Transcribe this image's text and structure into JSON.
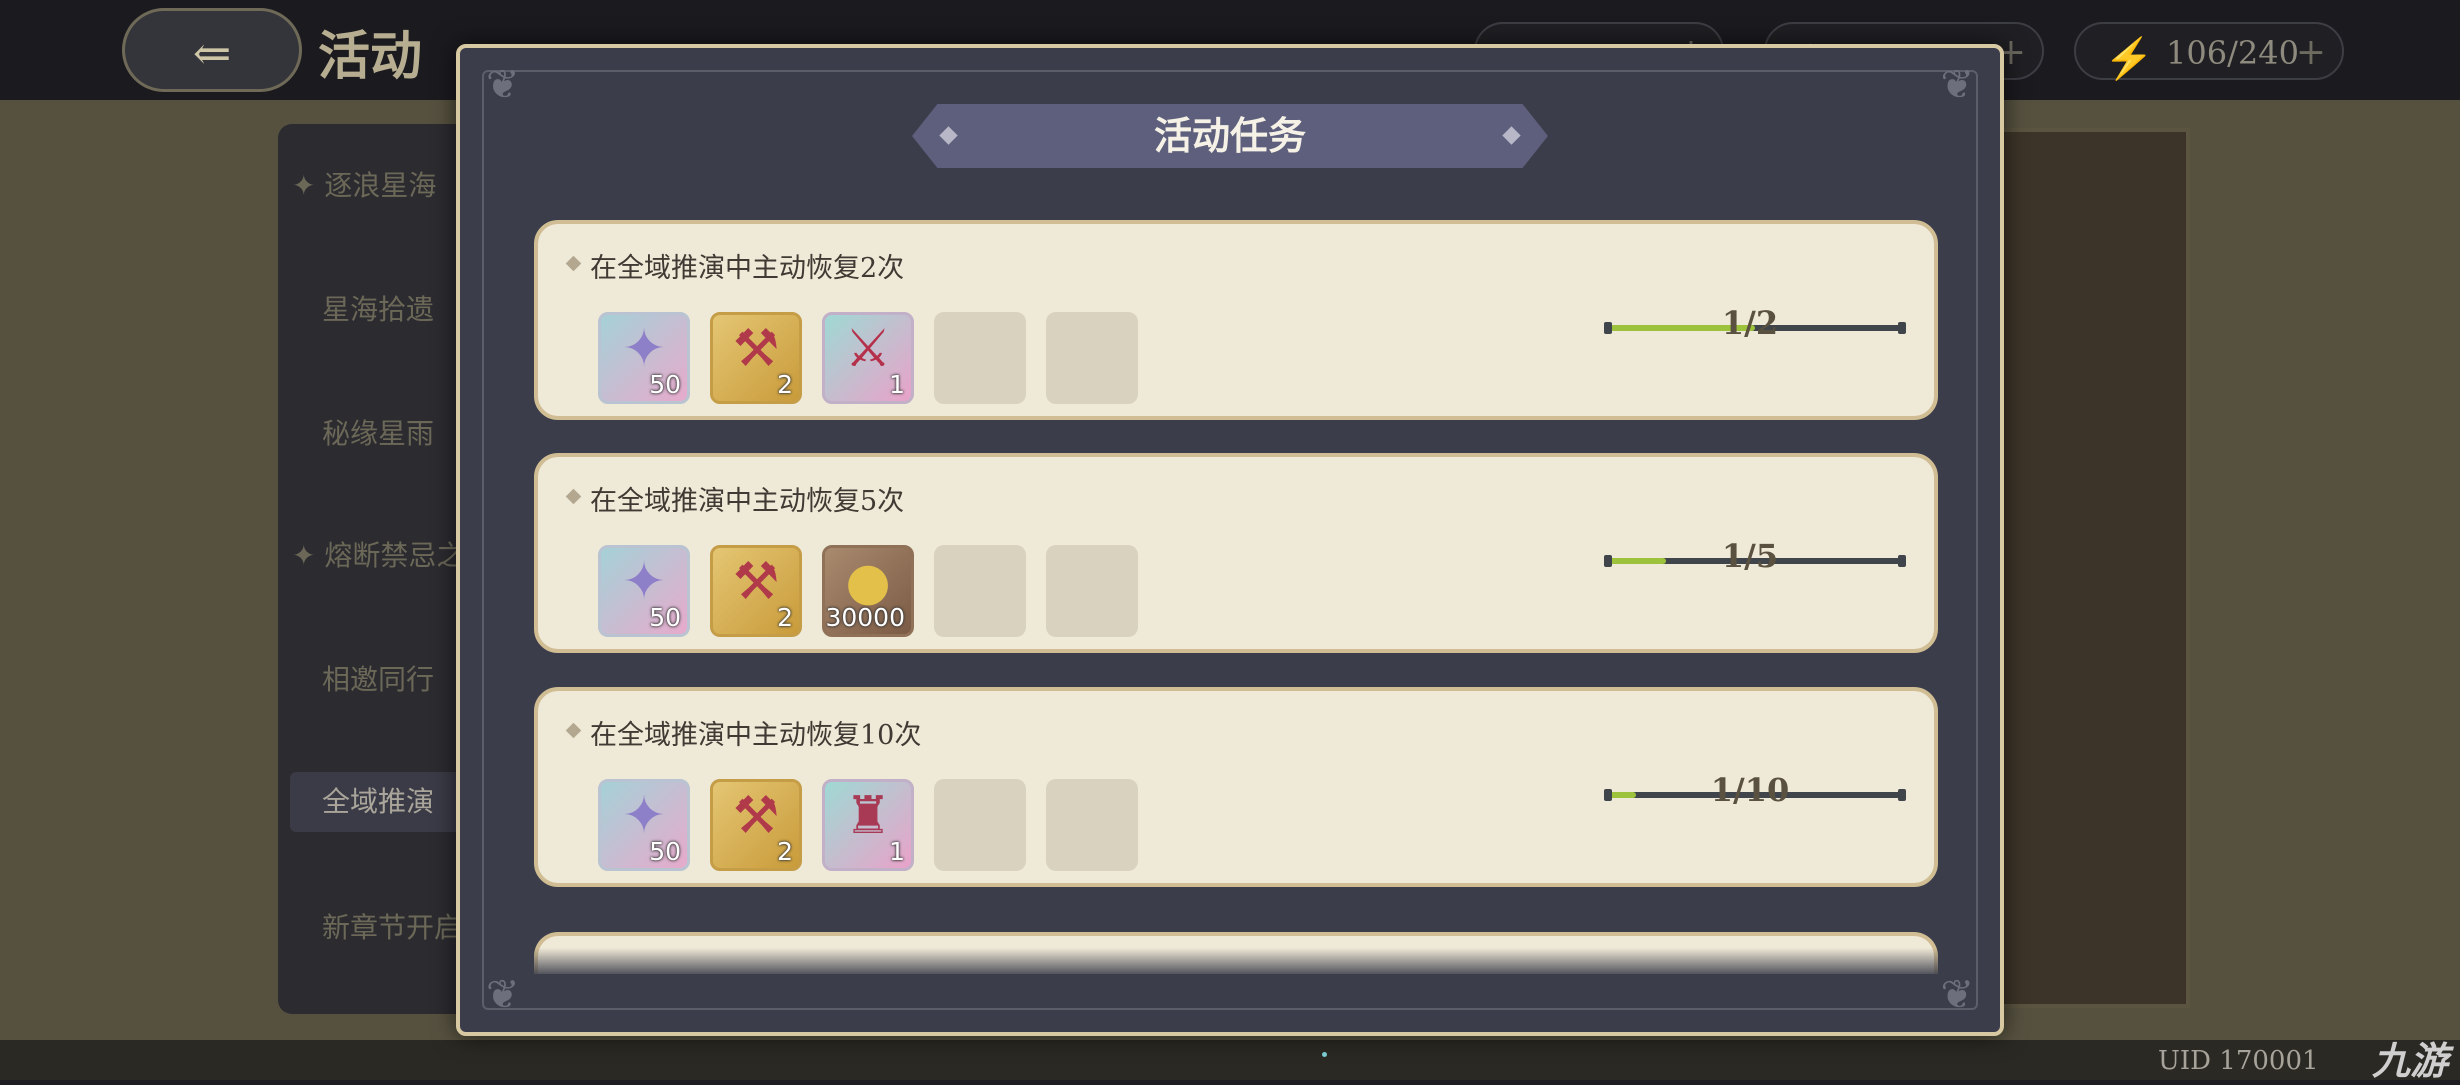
{
  "header": {
    "back_icon": "back-arrow-icon",
    "title": "活动",
    "resource_stamina": {
      "icon": "lightning-icon",
      "value": "106/240",
      "plus": "+"
    }
  },
  "sidebar": {
    "items": [
      {
        "label": "✦ 逐浪星海",
        "kind": "header"
      },
      {
        "label": "星海拾遗",
        "kind": "item"
      },
      {
        "label": "秘缘星雨",
        "kind": "item"
      },
      {
        "label": "✦ 熔断禁忌之",
        "kind": "header"
      },
      {
        "label": "相邀同行",
        "kind": "item"
      },
      {
        "label": "全域推演",
        "kind": "active"
      },
      {
        "label": "新章节开启",
        "kind": "item"
      }
    ]
  },
  "footer": {
    "uid": "UID 170001",
    "watermark": "九游"
  },
  "modal": {
    "title": "活动任务",
    "tasks": [
      {
        "title": "在全域推演中主动恢复2次",
        "progress_text": "1/2",
        "progress_fraction": 0.5,
        "rewards": [
          {
            "icon": "star-crystal-icon",
            "count": "50",
            "style": "blue"
          },
          {
            "icon": "hammer-icon",
            "count": "2",
            "style": "gold"
          },
          {
            "icon": "red-blade-icon",
            "count": "1",
            "style": "pink"
          }
        ]
      },
      {
        "title": "在全域推演中主动恢复5次",
        "progress_text": "1/5",
        "progress_fraction": 0.2,
        "rewards": [
          {
            "icon": "star-crystal-icon",
            "count": "50",
            "style": "blue"
          },
          {
            "icon": "hammer-icon",
            "count": "2",
            "style": "gold"
          },
          {
            "icon": "gold-coin-icon",
            "count": "30000",
            "style": "brown"
          }
        ]
      },
      {
        "title": "在全域推演中主动恢复10次",
        "progress_text": "1/10",
        "progress_fraction": 0.1,
        "rewards": [
          {
            "icon": "star-crystal-icon",
            "count": "50",
            "style": "blue"
          },
          {
            "icon": "hammer-icon",
            "count": "2",
            "style": "gold"
          },
          {
            "icon": "pagoda-icon",
            "count": "1",
            "style": "pink"
          }
        ]
      }
    ]
  }
}
